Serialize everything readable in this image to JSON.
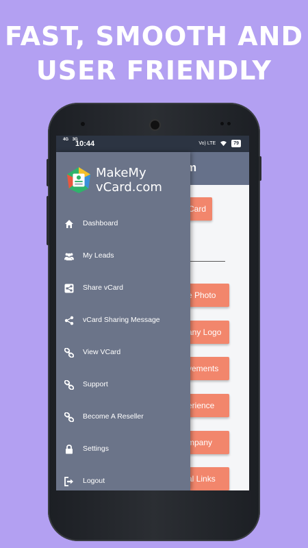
{
  "promo": {
    "line1": "FAST, SMOOTH AND",
    "line2": "USER FRIENDLY"
  },
  "status_bar": {
    "network_1": "4G",
    "network_2": "3G",
    "time": "10:44",
    "volte": "Vo) LTE",
    "battery": "79"
  },
  "app_bar": {
    "title_fragment": "m"
  },
  "background_buttons": [
    "Card",
    "e Photo",
    "any Logo",
    "vements",
    "erience",
    "mpany",
    "al Links"
  ],
  "drawer": {
    "logo": {
      "line1": "MakeMy",
      "line2": "vCard.com"
    },
    "items": [
      {
        "label": "Dashboard",
        "icon": "home-icon"
      },
      {
        "label": "My Leads",
        "icon": "users-icon"
      },
      {
        "label": "Share vCard",
        "icon": "share-square-icon"
      },
      {
        "label": "vCard Sharing Message",
        "icon": "share-nodes-icon"
      },
      {
        "label": "View VCard",
        "icon": "link-icon"
      },
      {
        "label": "Support",
        "icon": "link-icon"
      },
      {
        "label": "Become A Reseller",
        "icon": "link-icon"
      },
      {
        "label": "Settings",
        "icon": "lock-icon"
      },
      {
        "label": "Logout",
        "icon": "logout-icon"
      }
    ]
  },
  "colors": {
    "background": "#b3a0f2",
    "drawer": "#6b7489",
    "status_bar": "#2c3442",
    "accent_button": "#f2866c"
  }
}
